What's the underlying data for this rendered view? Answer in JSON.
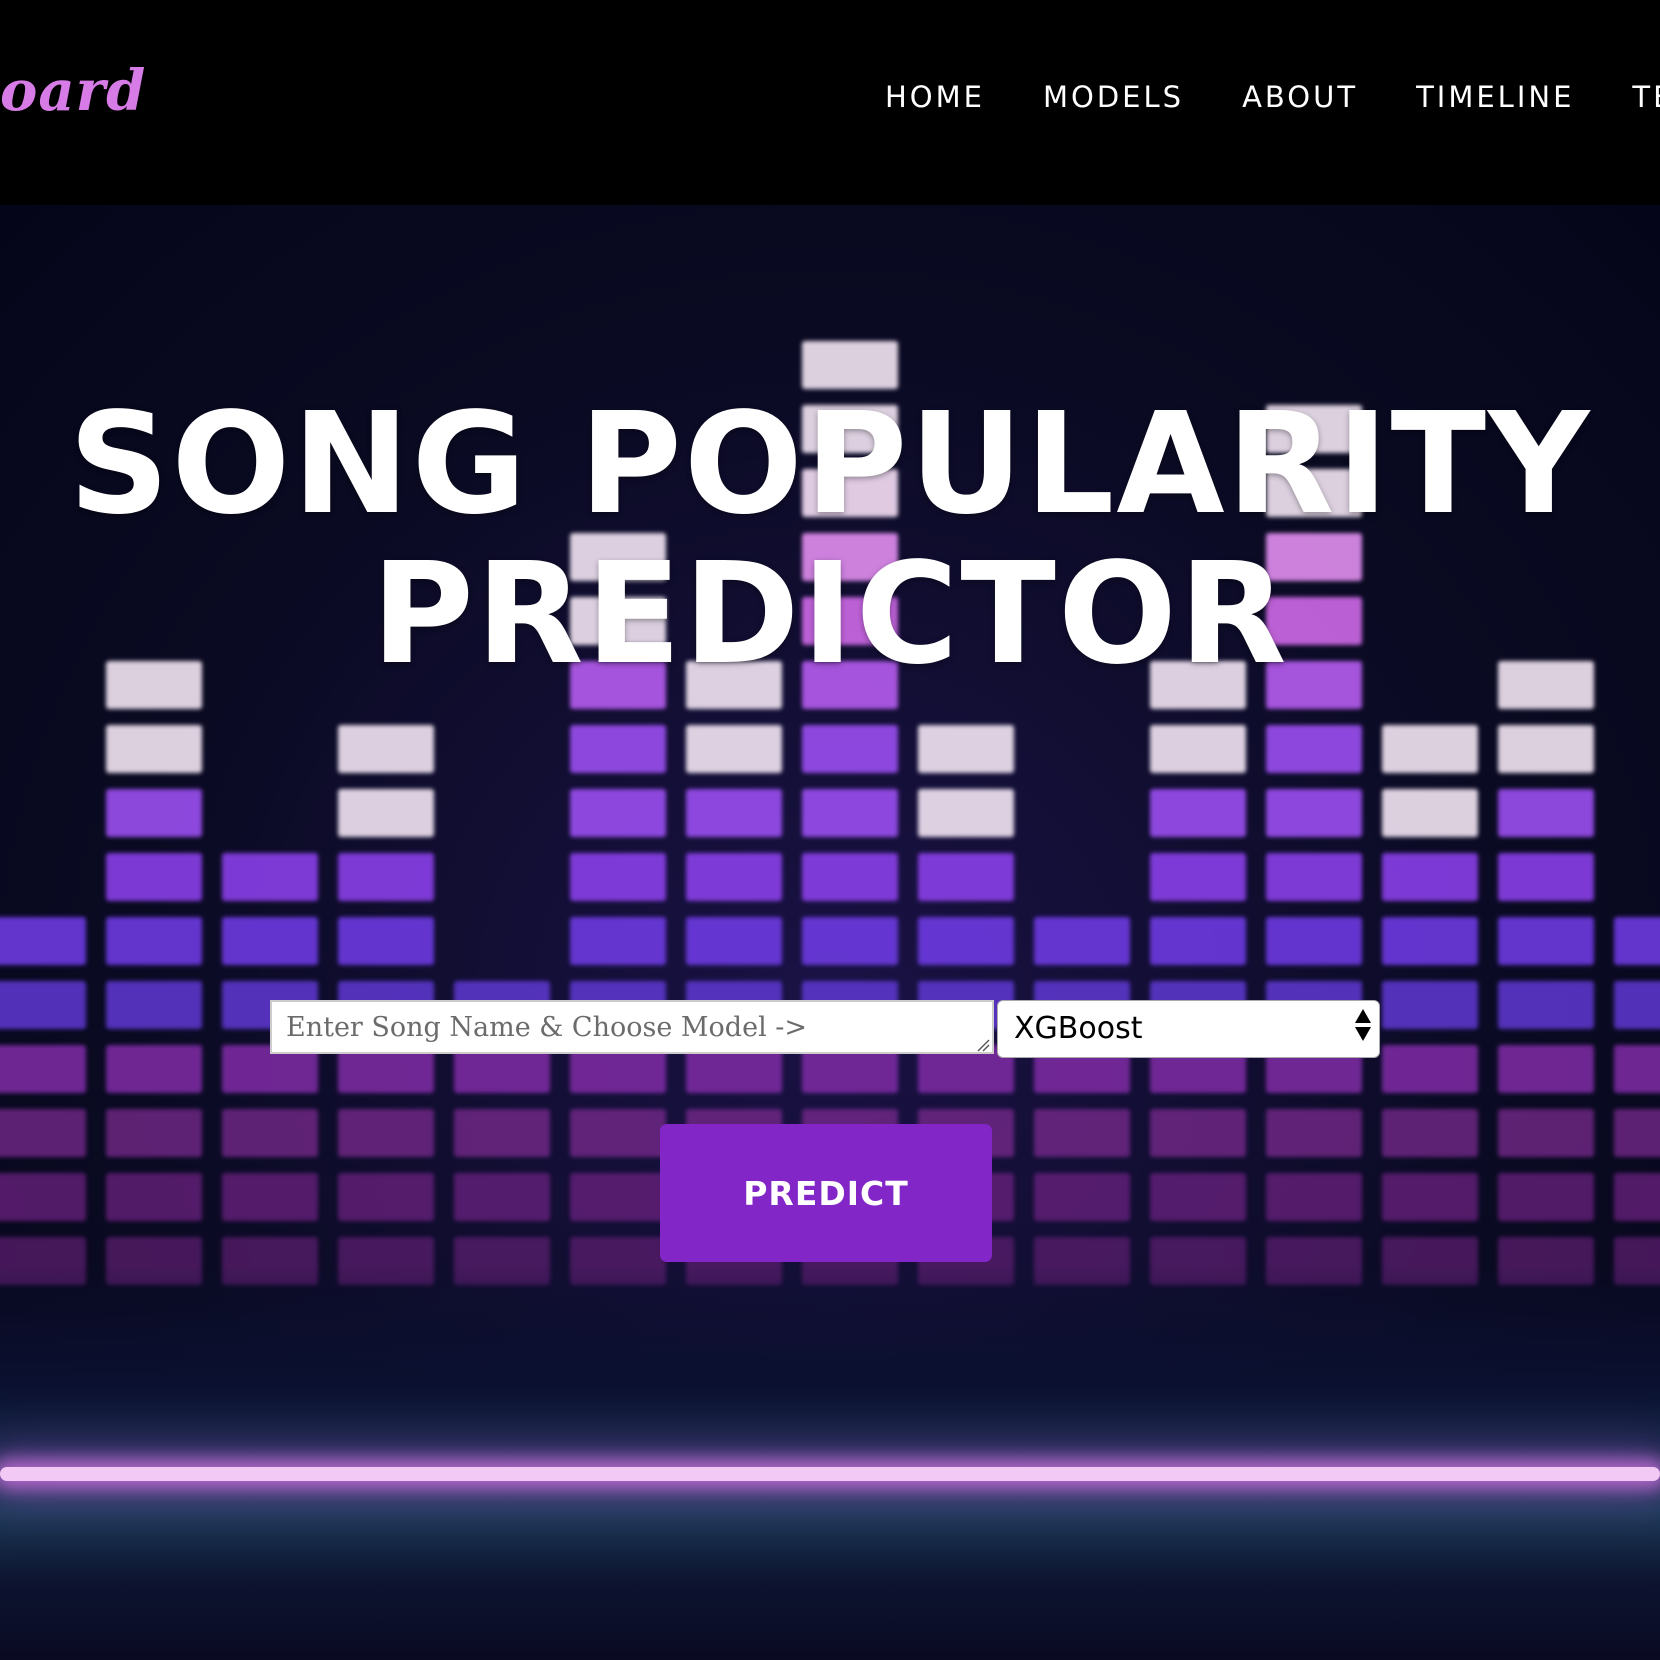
{
  "navbar": {
    "brand": "oard",
    "links": [
      {
        "label": "HOME"
      },
      {
        "label": "MODELS"
      },
      {
        "label": "ABOUT"
      },
      {
        "label": "TIMELINE"
      },
      {
        "label": "TE"
      }
    ]
  },
  "hero": {
    "title_line1": "SONG POPULARITY",
    "title_line2": "PREDICTOR"
  },
  "form": {
    "song_placeholder": "Enter Song Name & Choose Model ->",
    "model_selected": "XGBoost",
    "predict_label": "PREDICT"
  },
  "colors": {
    "accent": "#8226c8",
    "brand": "#d77be6",
    "glow": "#f2c9f5"
  },
  "icons": {
    "select_arrows": "up-down-caret-icon",
    "resize": "resize-grip-icon"
  }
}
